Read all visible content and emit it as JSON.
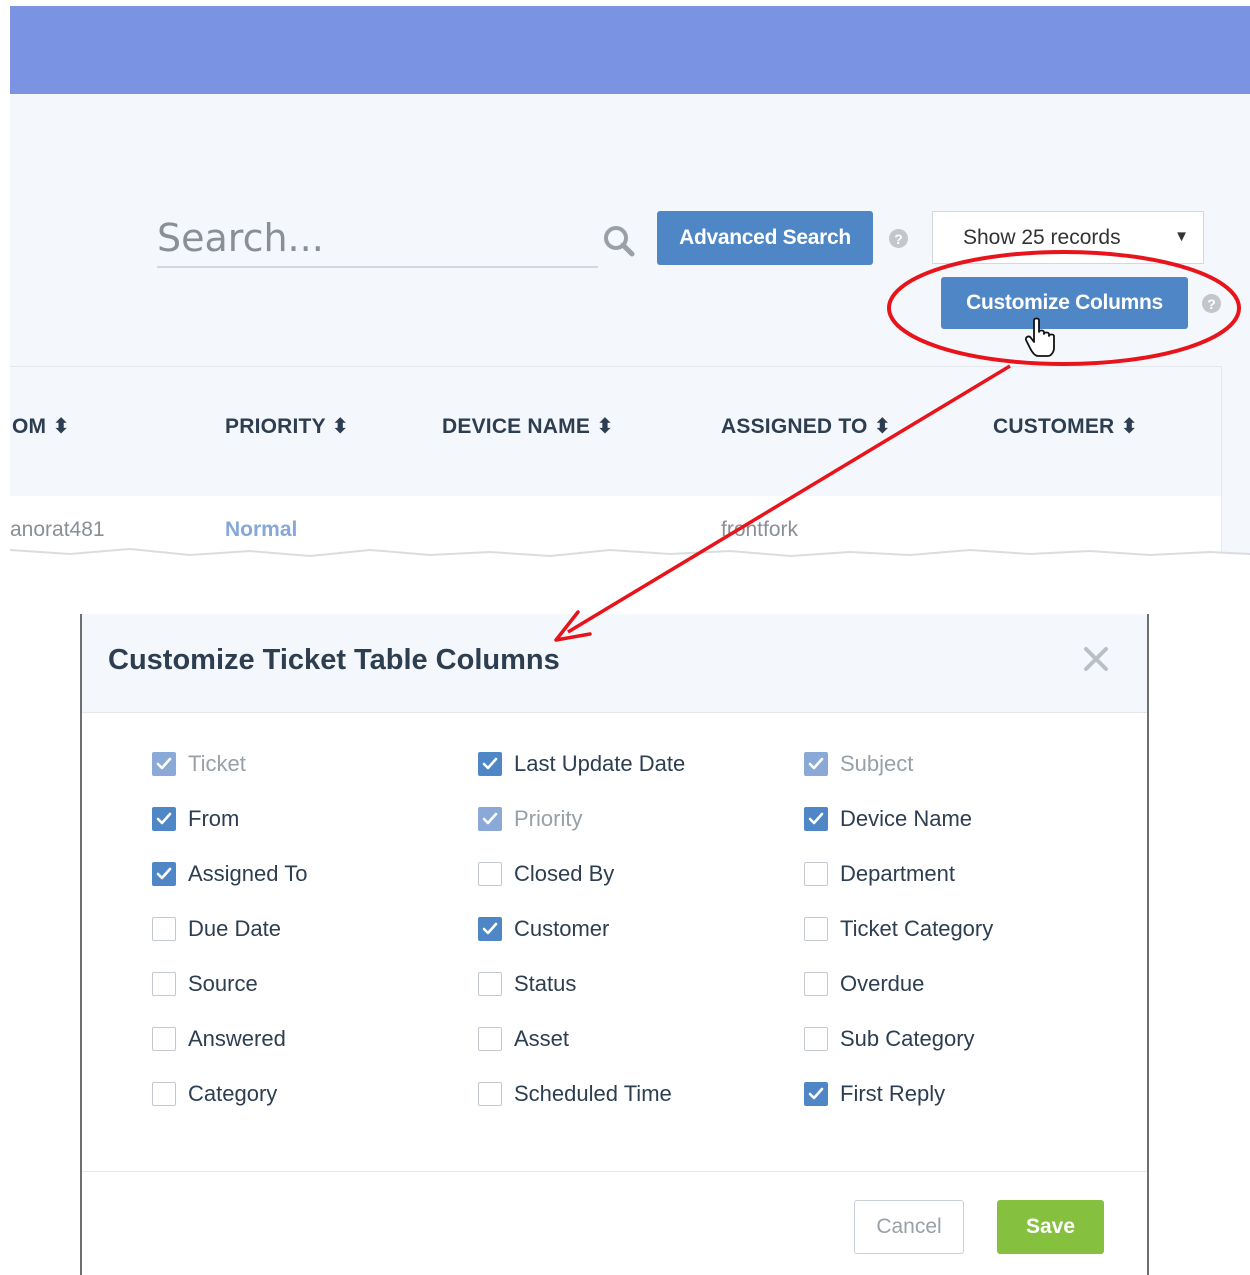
{
  "search": {
    "placeholder": "Search..."
  },
  "toolbar": {
    "advanced_search_label": "Advanced Search",
    "records_label": "Show 25 records",
    "customize_columns_label": "Customize Columns",
    "help_glyph": "?"
  },
  "table": {
    "headers": [
      "OM ⬍",
      "PRIORITY ⬍",
      "DEVICE NAME ⬍",
      "ASSIGNED TO ⬍",
      "CUSTOMER ⬍"
    ],
    "row": {
      "from": "anorat481",
      "priority": "Normal",
      "assigned_to": "frontfork"
    }
  },
  "modal": {
    "title": "Customize Ticket Table Columns",
    "cancel_label": "Cancel",
    "save_label": "Save",
    "options": [
      {
        "label": "Ticket",
        "checked": true,
        "disabled": true
      },
      {
        "label": "Last Update Date",
        "checked": true,
        "disabled": false
      },
      {
        "label": "Subject",
        "checked": true,
        "disabled": true
      },
      {
        "label": "From",
        "checked": true,
        "disabled": false
      },
      {
        "label": "Priority",
        "checked": true,
        "disabled": true
      },
      {
        "label": "Device Name",
        "checked": true,
        "disabled": false
      },
      {
        "label": "Assigned To",
        "checked": true,
        "disabled": false
      },
      {
        "label": "Closed By",
        "checked": false,
        "disabled": false
      },
      {
        "label": "Department",
        "checked": false,
        "disabled": false
      },
      {
        "label": "Due Date",
        "checked": false,
        "disabled": false
      },
      {
        "label": "Customer",
        "checked": true,
        "disabled": false
      },
      {
        "label": "Ticket Category",
        "checked": false,
        "disabled": false
      },
      {
        "label": "Source",
        "checked": false,
        "disabled": false
      },
      {
        "label": "Status",
        "checked": false,
        "disabled": false
      },
      {
        "label": "Overdue",
        "checked": false,
        "disabled": false
      },
      {
        "label": "Answered",
        "checked": false,
        "disabled": false
      },
      {
        "label": "Asset",
        "checked": false,
        "disabled": false
      },
      {
        "label": "Sub Category",
        "checked": false,
        "disabled": false
      },
      {
        "label": "Category",
        "checked": false,
        "disabled": false
      },
      {
        "label": "Scheduled Time",
        "checked": false,
        "disabled": false
      },
      {
        "label": "First Reply",
        "checked": true,
        "disabled": false
      }
    ]
  },
  "colors": {
    "header_band": "#7b93e3",
    "primary_button": "#4f86c6",
    "save_button": "#85c13f",
    "annotation": "#e8141b"
  },
  "icons": [
    "search-icon",
    "help-icon",
    "dropdown-arrow-icon",
    "close-icon",
    "checkmark-icon",
    "hand-cursor-icon"
  ]
}
